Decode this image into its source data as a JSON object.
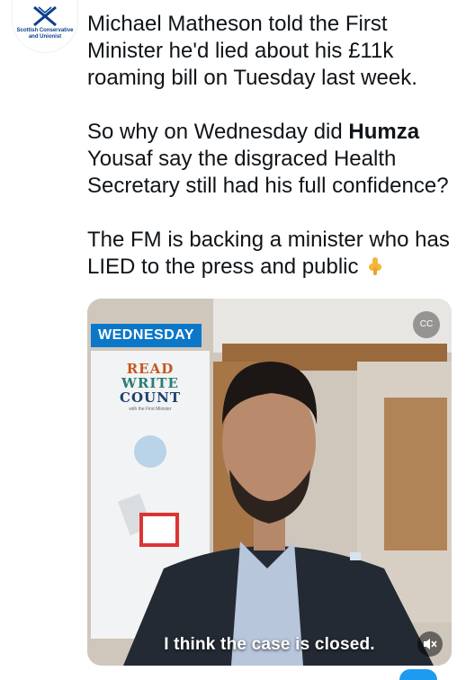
{
  "author": {
    "logo_line1": "Scottish Conservative",
    "logo_line2": "and Unionist",
    "brand_color": "#0a3f8c"
  },
  "tweet": {
    "p1": "Michael Matheson told the First Minister he'd lied about his £11k roaming bill on Tuesday last week.",
    "p2_pre": "So why on Wednesday did ",
    "p2_bold": "Humza",
    "p2_post": " Yousaf say the disgraced Health Secretary still had his full confidence?",
    "p3": "The FM is backing a minister who has LIED to the press and public",
    "emoji": "pointing-down-hand-icon"
  },
  "video": {
    "day_badge": "WEDNESDAY",
    "banner_read": "READ",
    "banner_write": "WRITE",
    "banner_count": "COUNT",
    "banner_small": "with the First Minister",
    "caption": "I think the case is closed.",
    "cc_label": "CC",
    "mute_icon": "speaker-muted-icon"
  }
}
